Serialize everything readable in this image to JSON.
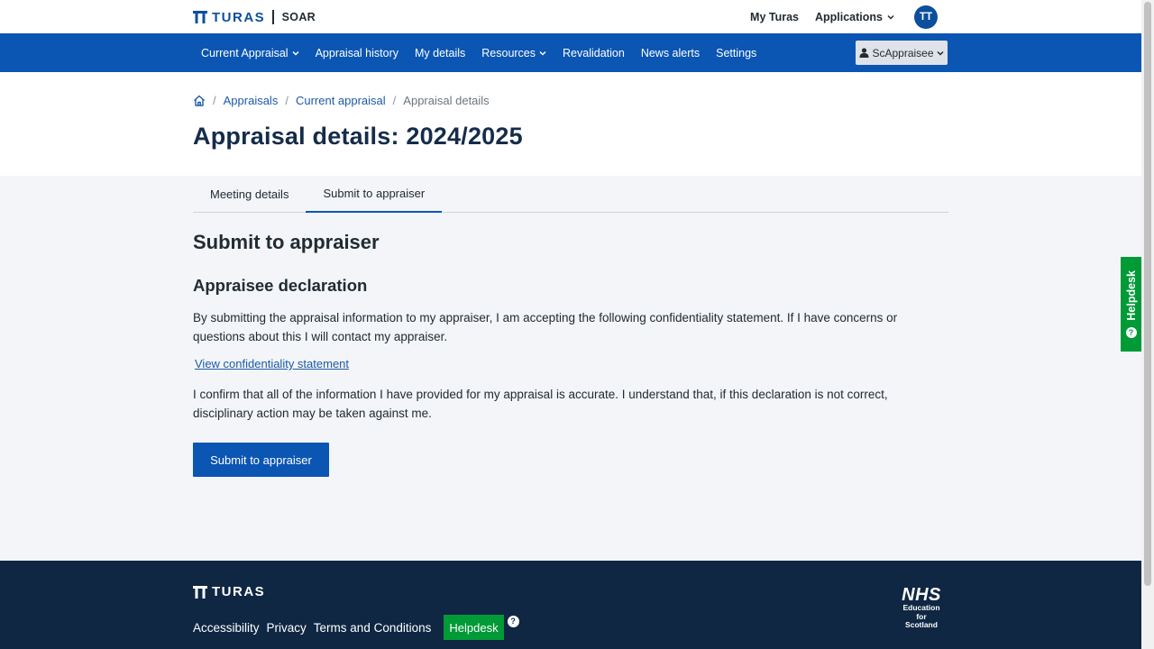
{
  "header": {
    "brand": "TURAS",
    "app_name": "SOAR",
    "my_turas": "My Turas",
    "applications": "Applications",
    "avatar_initials": "TT"
  },
  "nav": {
    "items": [
      {
        "label": "Current Appraisal",
        "dropdown": true
      },
      {
        "label": "Appraisal history",
        "dropdown": false
      },
      {
        "label": "My details",
        "dropdown": false
      },
      {
        "label": "Resources",
        "dropdown": true
      },
      {
        "label": "Revalidation",
        "dropdown": false
      },
      {
        "label": "News alerts",
        "dropdown": false
      },
      {
        "label": "Settings",
        "dropdown": false
      }
    ],
    "user_menu_label": "ScAppraisee"
  },
  "breadcrumb": {
    "home_icon": "home-icon",
    "items": [
      "Appraisals",
      "Current appraisal"
    ],
    "current": "Appraisal details"
  },
  "page_title": "Appraisal details: 2024/2025",
  "tabs": [
    {
      "label": "Meeting details",
      "active": false
    },
    {
      "label": "Submit to appraiser",
      "active": true
    }
  ],
  "main": {
    "section_title": "Submit to appraiser",
    "subsection_title": "Appraisee declaration",
    "paragraph1": "By submitting the appraisal information to my appraiser, I am accepting the following confidentiality statement. If I have concerns or questions about this I will contact my appraiser.",
    "confidentiality_link": "View confidentiality statement",
    "paragraph2": "I confirm that all of the information I have provided for my appraisal is accurate. I understand that, if this declaration is not correct, disciplinary action may be taken against me.",
    "submit_button": "Submit to appraiser"
  },
  "side_helpdesk": "Helpdesk",
  "footer": {
    "brand": "TURAS",
    "links": [
      "Accessibility",
      "Privacy",
      "Terms and Conditions"
    ],
    "helpdesk": "Helpdesk",
    "logo_nhs": "NHS",
    "logo_lines": [
      "Education",
      "for",
      "Scotland"
    ]
  },
  "colors": {
    "primary": "#0b55b3",
    "brand_text": "#0b4f9e",
    "help_green": "#009a37",
    "footer_bg": "#0f2743",
    "content_bg": "#f3f5f8"
  }
}
